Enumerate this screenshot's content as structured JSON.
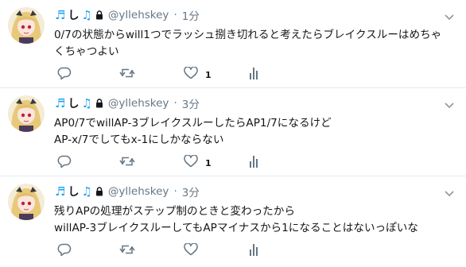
{
  "tweets": [
    {
      "name": "し",
      "handle": "@yllehskey",
      "separator": "·",
      "time": "1分",
      "body": "0/7の状態からwill1つでラッシュ捌き切れると考えたらブレイクスルーはめちゃ\nくちゃつよい",
      "like_count": "1"
    },
    {
      "name": "し",
      "handle": "@yllehskey",
      "separator": "·",
      "time": "3分",
      "body": "AP0/7でwillAP-3ブレイクスルーしたらAP1/7になるけど\nAP-x/7でしてもx-1にしかならない",
      "like_count": "1"
    },
    {
      "name": "し",
      "handle": "@yllehskey",
      "separator": "·",
      "time": "3分",
      "body": "残りAPの処理がステップ制のときと変わったから\nwillAP-3ブレイクスルーしてもAPマイナスから1になることはないっぽいな",
      "like_count": ""
    }
  ],
  "icons": {
    "note": "musical-note-icon",
    "lock": "lock-icon",
    "menu": "chevron-down-icon",
    "reply": "reply-icon",
    "retweet": "retweet-icon",
    "like": "heart-icon",
    "stats": "analytics-icon"
  },
  "colors": {
    "accent": "#1da1f2",
    "secondary_text": "#657786",
    "divider": "#e6ecf0"
  }
}
